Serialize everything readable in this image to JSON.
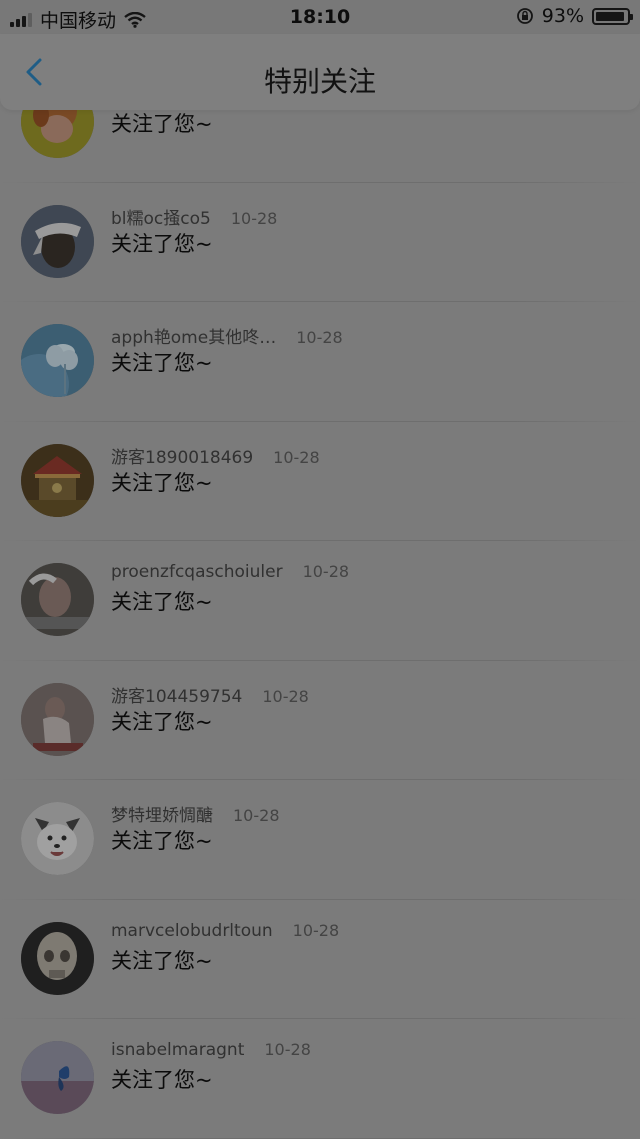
{
  "status_bar": {
    "carrier": "中国移动",
    "time": "18:10",
    "battery": "93%",
    "battery_level": 0.93
  },
  "nav": {
    "title": "特别关注",
    "back_icon": "chevron-left-icon"
  },
  "colors": {
    "accent": "#1f5d86",
    "overlay_bg": "#7b7b7b"
  },
  "list": {
    "items": [
      {
        "name": "",
        "date": "",
        "message": "关注了您~",
        "avatar": "cartoon-girl-avatar"
      },
      {
        "name": "bl糯oc掻co5",
        "date": "10-28",
        "message": "关注了您~",
        "avatar": "man-bandana-avatar"
      },
      {
        "name": "apph艳ome其他咚…",
        "date": "10-28",
        "message": "关注了您~",
        "avatar": "flower-avatar"
      },
      {
        "name": "游客1890018469",
        "date": "10-28",
        "message": "关注了您~",
        "avatar": "carousel-avatar"
      },
      {
        "name": "proenzfcqaschoiuler",
        "date": "10-28",
        "message": "关注了您~",
        "avatar": "girl-smoke-avatar"
      },
      {
        "name": "游客104459754",
        "date": "10-28",
        "message": "关注了您~",
        "avatar": "girl-sitting-avatar"
      },
      {
        "name": "梦特埋娇惆醣",
        "date": "10-28",
        "message": "关注了您~",
        "avatar": "dog-avatar"
      },
      {
        "name": "marvcelobudrltoun",
        "date": "10-28",
        "message": "关注了您~",
        "avatar": "skull-avatar"
      },
      {
        "name": "isnabelmaragnt",
        "date": "10-28",
        "message": "关注了您~",
        "avatar": "butterfly-avatar"
      }
    ]
  }
}
